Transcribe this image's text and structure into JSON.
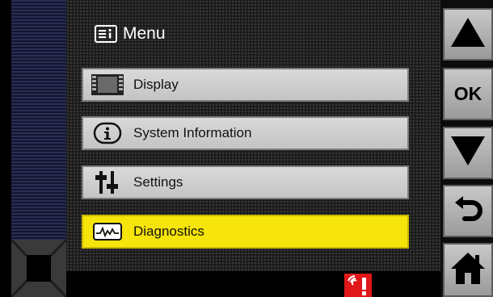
{
  "header": {
    "title": "Menu"
  },
  "menu": {
    "items": [
      {
        "label": "Display",
        "icon": "display-icon",
        "selected": false
      },
      {
        "label": "System Information",
        "icon": "info-icon",
        "selected": false
      },
      {
        "label": "Settings",
        "icon": "settings-sliders-icon",
        "selected": false
      },
      {
        "label": "Diagnostics",
        "icon": "diagnostics-waveform-icon",
        "selected": true
      }
    ]
  },
  "side_buttons": {
    "up": {
      "icon": "arrow-up-icon"
    },
    "ok": {
      "label": "OK"
    },
    "down": {
      "icon": "arrow-down-icon"
    },
    "back": {
      "icon": "back-arrow-icon"
    },
    "home": {
      "icon": "home-icon"
    }
  },
  "status": {
    "alert_icon": "alarm-warning-icon"
  },
  "colors": {
    "selected_highlight": "#f6e40a",
    "menu_item_bg": "#cfcfcf",
    "alert_red": "#e0181a",
    "side_button": "#b5b5b5"
  }
}
